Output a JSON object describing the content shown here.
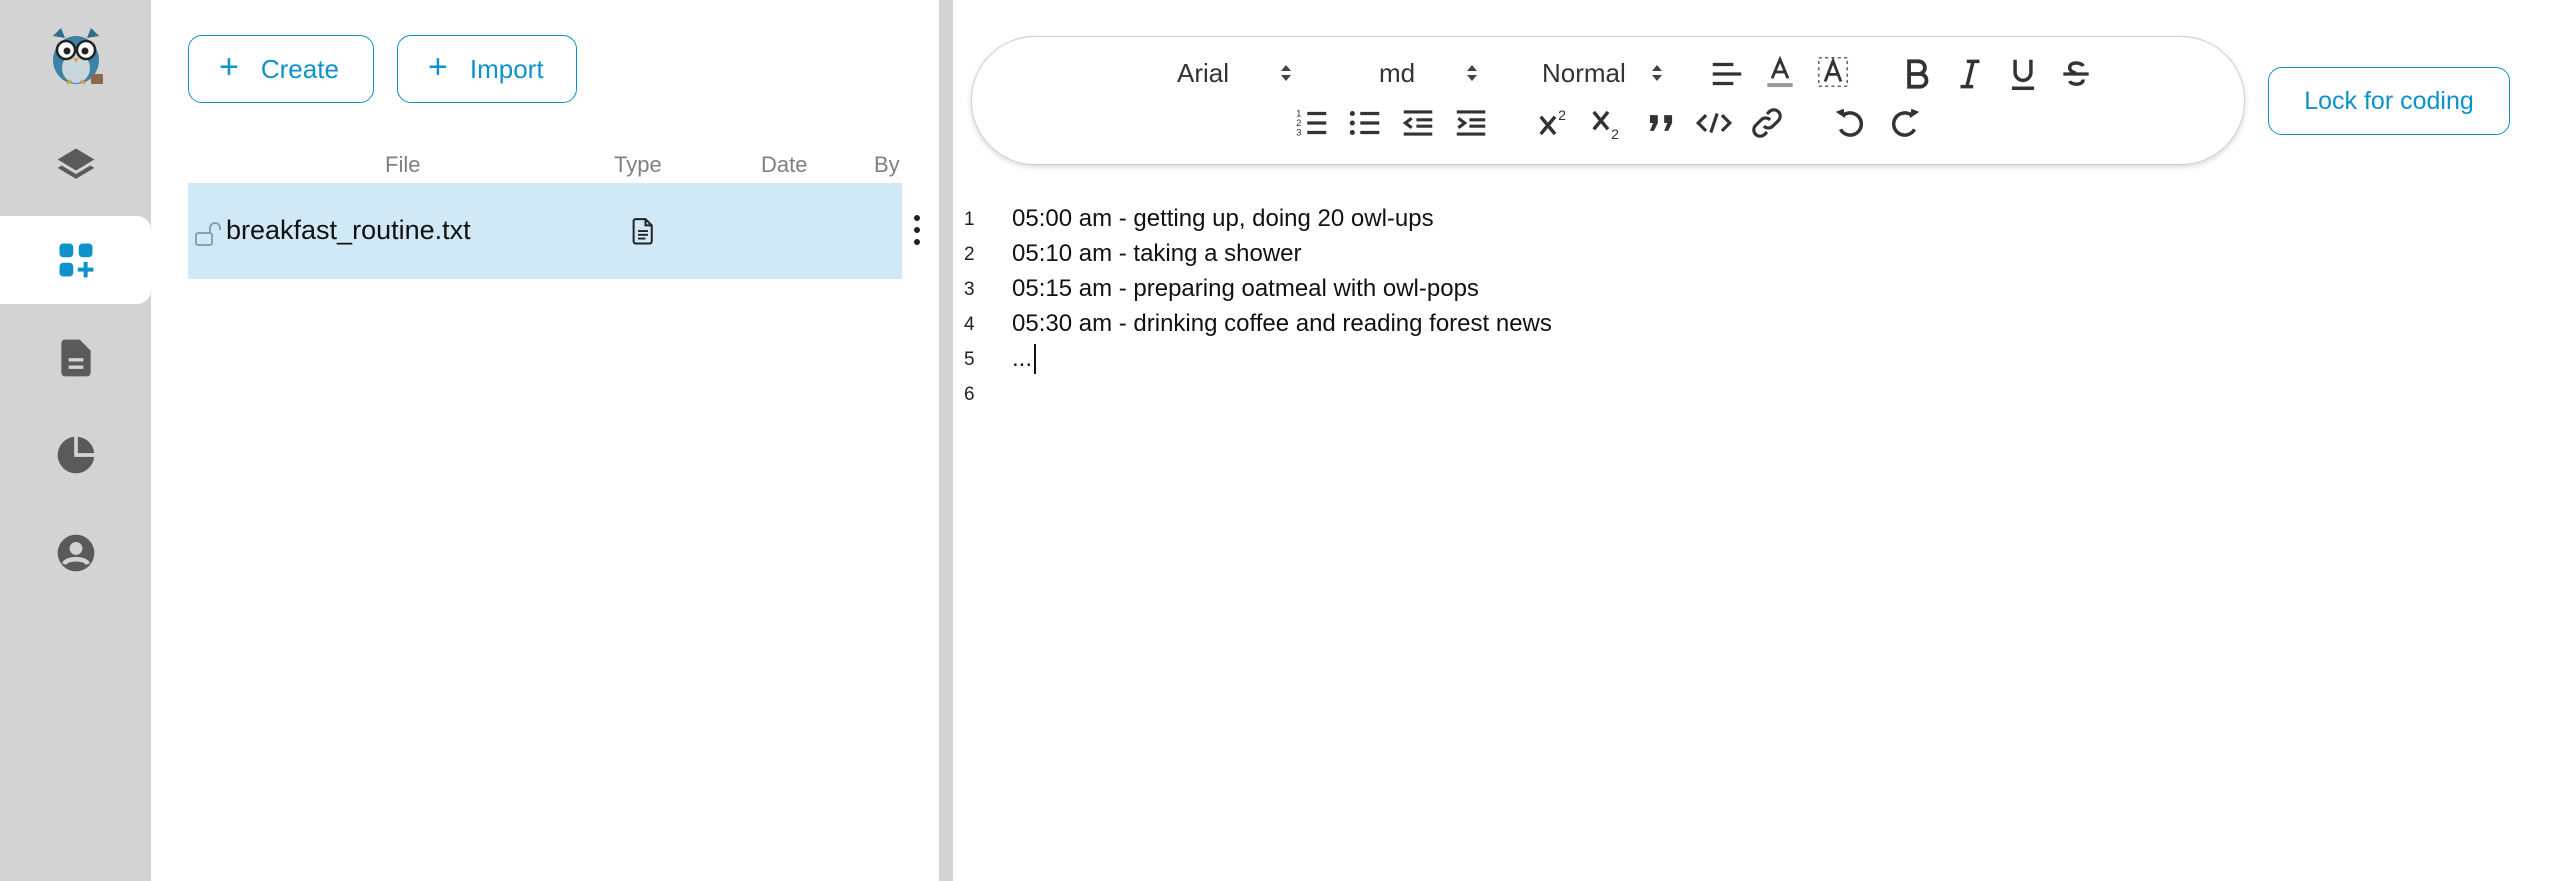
{
  "sidebar": {
    "items": [
      {
        "icon": "layers-icon",
        "active": false
      },
      {
        "icon": "apps-add-icon",
        "active": true
      },
      {
        "icon": "document-icon",
        "active": false
      },
      {
        "icon": "pie-chart-icon",
        "active": false
      },
      {
        "icon": "account-icon",
        "active": false
      }
    ]
  },
  "files": {
    "create_label": "Create",
    "import_label": "Import",
    "columns": [
      "File",
      "Type",
      "Date",
      "By"
    ],
    "rows": [
      {
        "name": "breakfast_routine.txt",
        "type_icon": "text-file-icon",
        "date": "",
        "by": ""
      }
    ]
  },
  "toolbar": {
    "font": "Arial",
    "size": "md",
    "style": "Normal"
  },
  "lock_button_label": "Lock for coding",
  "editor": {
    "lines": [
      {
        "num": "1",
        "text": "05:00 am - getting up, doing 20 owl-ups"
      },
      {
        "num": "2",
        "text": "05:10 am - taking a shower"
      },
      {
        "num": "3",
        "text": "05:15 am - preparing oatmeal with owl-pops"
      },
      {
        "num": "4",
        "text": "05:30 am - drinking coffee and reading forest news"
      },
      {
        "num": "5",
        "text": "..."
      },
      {
        "num": "6",
        "text": ""
      }
    ]
  },
  "colors": {
    "accent": "#0d93c9",
    "rail_bg": "#d3d3d3",
    "selected_row": "#d1e8f6",
    "icon_gray": "#5a5a5a"
  }
}
